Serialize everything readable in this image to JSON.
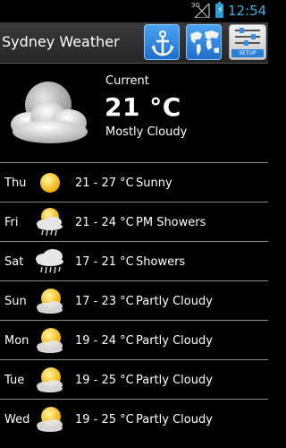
{
  "status_bar": {
    "network": "3G",
    "time": "12:54"
  },
  "header": {
    "title": "Sydney Weather",
    "buttons": {
      "setup_label": "SETUP"
    }
  },
  "current": {
    "label": "Current",
    "temperature": "21 °C",
    "condition": "Mostly Cloudy",
    "icon": "moon-cloud-icon"
  },
  "forecast": [
    {
      "day": "Thu",
      "range": "21 - 27 °C",
      "condition": "Sunny",
      "icon": "sun-icon"
    },
    {
      "day": "Fri",
      "range": "21 - 24 °C",
      "condition": "PM Showers",
      "icon": "sun-cloud-rain-icon"
    },
    {
      "day": "Sat",
      "range": "17 - 21 °C",
      "condition": "Showers",
      "icon": "cloud-rain-icon"
    },
    {
      "day": "Sun",
      "range": "17 - 23 °C",
      "condition": "Partly Cloudy",
      "icon": "sun-cloud-icon"
    },
    {
      "day": "Mon",
      "range": "19 - 24 °C",
      "condition": "Partly Cloudy",
      "icon": "sun-cloud-icon"
    },
    {
      "day": "Tue",
      "range": "19 - 25 °C",
      "condition": "Partly Cloudy",
      "icon": "sun-cloud-icon"
    },
    {
      "day": "Wed",
      "range": "19 - 25 °C",
      "condition": "Partly Cloudy",
      "icon": "sun-cloud-icon"
    }
  ],
  "colors": {
    "accent": "#33b5e5",
    "button_blue": "#1f6fc9",
    "divider": "#8a8a8a"
  }
}
